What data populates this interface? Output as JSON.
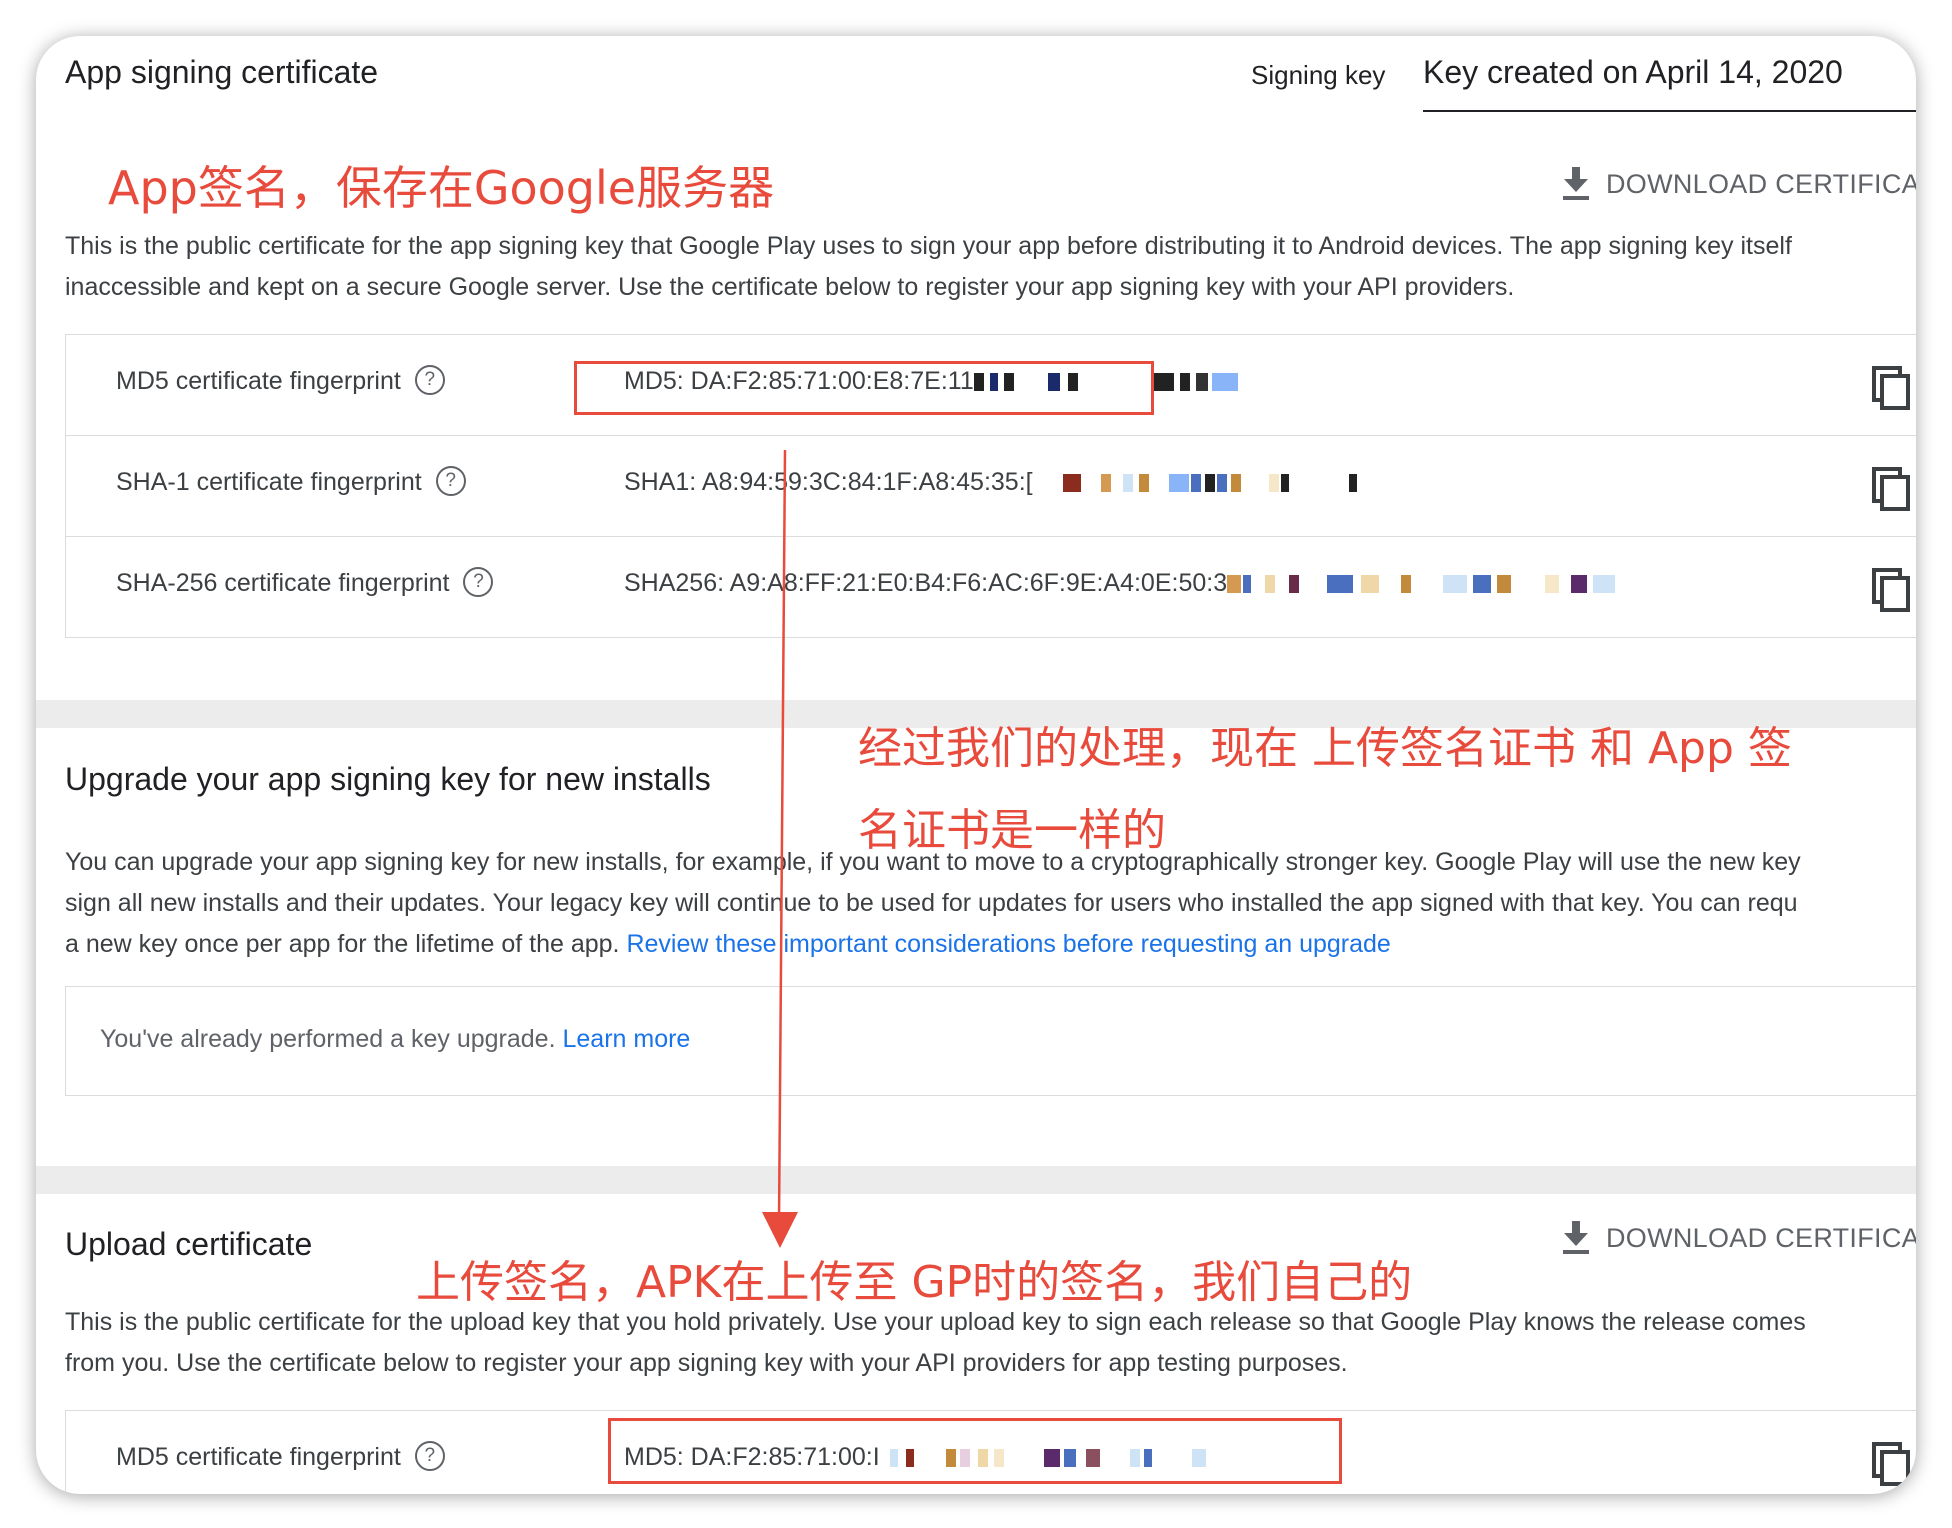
{
  "app_signing": {
    "title": "App signing certificate",
    "signing_key_label": "Signing key",
    "signing_key_value": "Key created on April 14, 2020",
    "download_label": "DOWNLOAD CERTIFICAT",
    "description_line1": "This is the public certificate for the app signing key that Google Play uses to sign your app before distributing it to Android devices. The app signing key itself",
    "description_line2": "inaccessible and kept on a secure Google server. Use the certificate below to register your app signing key with your API providers.",
    "fingerprints": [
      {
        "label": "MD5 certificate fingerprint",
        "value": "MD5: DA:F2:85:71:00:E8:7E:11"
      },
      {
        "label": "SHA-1 certificate fingerprint",
        "value": "SHA1: A8:94:59:3C:84:1F:A8:45:35:["
      },
      {
        "label": "SHA-256 certificate fingerprint",
        "value": "SHA256: A9:A8:FF:21:E0:B4:F6:AC:6F:9E:A4:0E:50:3"
      }
    ]
  },
  "upgrade": {
    "title": "Upgrade your app signing key for new installs",
    "description_line1": "You can upgrade your app signing key for new installs, for example, if you want to move to a cryptographically stronger key. Google Play will use the new key",
    "description_line2": "sign all new installs and their updates. Your legacy key will continue to be used for updates for users who installed the app signed with that key. You can requ",
    "description_line3": "a new key once per app for the lifetime of the app.",
    "review_link": "Review these important considerations before requesting an upgrade",
    "notice_text": "You've already performed a key upgrade.",
    "learn_more": "Learn more"
  },
  "upload": {
    "title": "Upload certificate",
    "download_label": "DOWNLOAD CERTIFICAT",
    "description_line1": "This is the public certificate for the upload key that you hold privately. Use your upload key to sign each release so that Google Play knows the release comes",
    "description_line2": "from you. Use the certificate below to register your app signing key with your API providers for app testing purposes.",
    "fingerprints": [
      {
        "label": "MD5 certificate fingerprint",
        "value": "MD5: DA:F2:85:71:00:I"
      }
    ]
  },
  "annotations": {
    "app_sign_note": "App签名，保存在Google服务器",
    "same_note_line1": "经过我们的处理，现在 上传签名证书 和 App 签",
    "same_note_line2": "名证书是一样的",
    "upload_note": "上传签名，APK在上传至 GP时的签名，我们自己的"
  },
  "colors": {
    "annotation_red": "#e84a3c",
    "link_blue": "#1a73e8",
    "text_dark": "#202124",
    "text_body": "#3c4043",
    "divider_gray": "#ececec"
  },
  "icons": {
    "download": "download-icon",
    "copy": "copy-icon",
    "help": "help-circle-icon"
  }
}
